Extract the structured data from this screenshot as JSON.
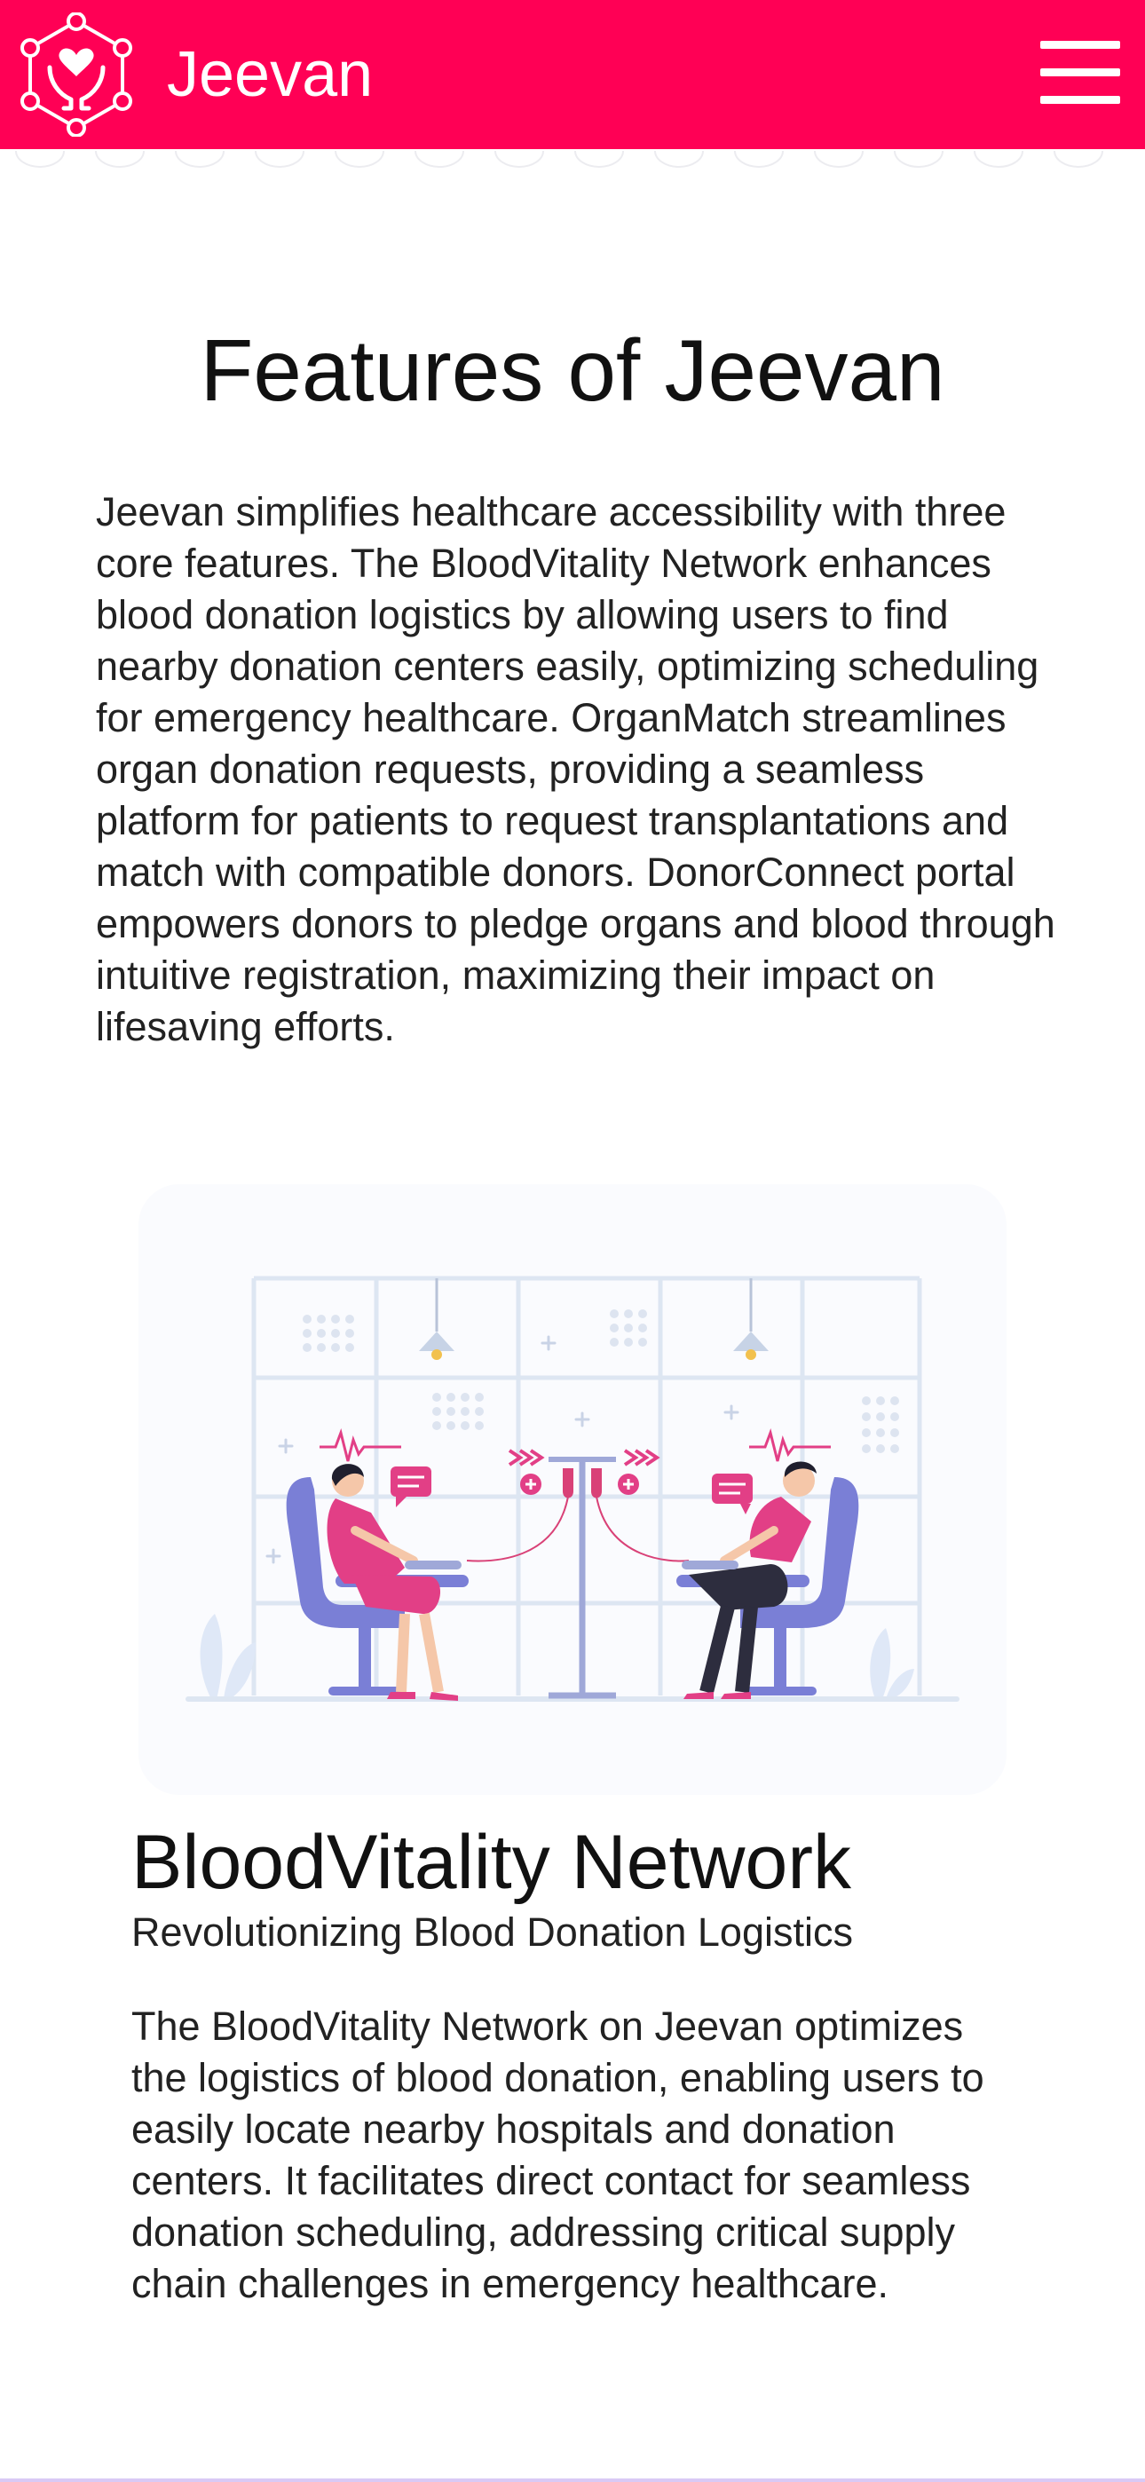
{
  "header": {
    "brand": "Jeevan",
    "background_color": "#ff0055",
    "logo_icon": "hands-heart-hexagon-icon",
    "menu_icon": "hamburger-menu-icon"
  },
  "features": {
    "title": "Features of Jeevan",
    "intro": "Jeevan simplifies healthcare accessibility with three core features. The BloodVitality Network enhances blood donation logistics by allowing users to find nearby donation centers easily, optimizing scheduling for emergency healthcare. OrganMatch streamlines organ donation requests, providing a seamless platform for patients to request transplantations and match with compatible donors. DonorConnect portal empowers donors to pledge organs and blood through intuitive registration, maximizing their impact on lifesaving efforts."
  },
  "feature_card": {
    "illustration": "blood-donation-illustration",
    "title": "BloodVitality Network",
    "subtitle": "Revolutionizing Blood Donation Logistics",
    "body": "The BloodVitality Network on Jeevan optimizes the logistics of blood donation, enabling users to easily locate nearby hospitals and donation centers. It facilitates direct contact for seamless donation scheduling, addressing critical supply chain challenges in emergency healthcare."
  }
}
